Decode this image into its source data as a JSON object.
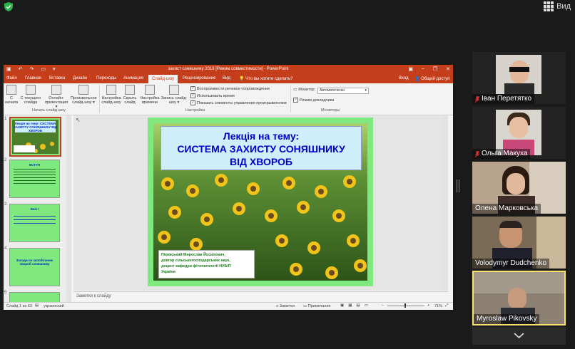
{
  "zoom": {
    "view_label": "Вид",
    "colors": {
      "background": "#1a1a1a",
      "shield": "#2bb24c",
      "active_speaker": "#f5e36b"
    }
  },
  "ppt": {
    "window_title": "захист соняшнику 2016 [Режим совместимости] - PowerPoint",
    "tabs": [
      "Файл",
      "Главная",
      "Вставка",
      "Дизайн",
      "Переходы",
      "Анимация",
      "Слайд-шоу",
      "Рецензирование",
      "Вид"
    ],
    "active_tab": "Слайд-шоу",
    "tell_me": "Что вы хотите сделать?",
    "sign_in": "Вход",
    "share": "Общий доступ",
    "ribbon": {
      "start_buttons": [
        {
          "l1": "С",
          "l2": "начала"
        },
        {
          "l1": "С текущего",
          "l2": "слайда"
        },
        {
          "l1": "Онлайн-",
          "l2": "презентация ▾"
        },
        {
          "l1": "Произвольное",
          "l2": "слайд-шоу ▾"
        }
      ],
      "setup_buttons": [
        {
          "l1": "Настройка",
          "l2": "слайд-шоу"
        },
        {
          "l1": "Скрыть",
          "l2": "слайд"
        },
        {
          "l1": "Настройка",
          "l2": "времени"
        },
        {
          "l1": "Запись слайд-",
          "l2": "шоу ▾"
        }
      ],
      "checkboxes": [
        "Воспроизвести речевое сопровождение",
        "Использовать время",
        "Показать элементы управления проигрывателем"
      ],
      "monitor_label": "Монитор:",
      "monitor_value": "Автоматически",
      "presenter_view": "Режим докладчика",
      "groups": [
        "Начать слайд-шоу",
        "Настройка",
        "Мониторы"
      ]
    },
    "thumbnails": [
      {
        "num": "1",
        "title": "Лекція на тему: СИСТЕМА ЗАХИСТУ СОНЯШНИКУ ВІД ХВОРОБ"
      },
      {
        "num": "2",
        "title": "ВСТУП"
      },
      {
        "num": "3",
        "title": "Зміст"
      },
      {
        "num": "4",
        "title": "Заходи по запобіганню хвороб соняшнику"
      },
      {
        "num": "5",
        "title": ""
      }
    ],
    "slide": {
      "title_line1": "Лекція на тему:",
      "title_line2": "СИСТЕМА ЗАХИСТУ СОНЯШНИКУ",
      "title_line3": "ВІД ХВОРОБ",
      "author_lines": [
        "Піковський Мирослав Йосипович,",
        "доктор сільськогосподарських наук,",
        "доцент кафедри фітопатології НУБіП",
        "України"
      ]
    },
    "notes_placeholder": "Заметки к слайду",
    "status": {
      "slide_counter": "Слайд 1 из 63",
      "language": "украинский",
      "notes_btn": "Заметки",
      "comments_btn": "Примечания",
      "zoom": "71%"
    }
  },
  "participants": [
    {
      "name": "Іван Перетятко",
      "muted": true
    },
    {
      "name": "Ольга Макуха",
      "muted": true
    },
    {
      "name": "Олена Марковська",
      "muted": false
    },
    {
      "name": "Volodymyr Dudchenko",
      "muted": false
    },
    {
      "name": "Myroslaw Pikovsky",
      "muted": false,
      "active": true
    }
  ]
}
